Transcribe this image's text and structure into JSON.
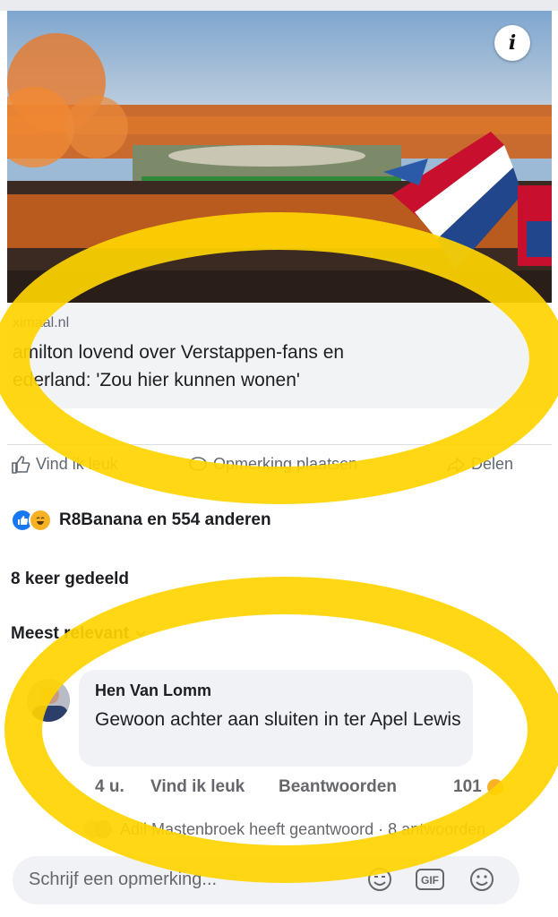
{
  "hero": {
    "info_glyph": "i"
  },
  "link": {
    "domain": "ximaal.nl",
    "headline_line1": "amilton lovend over Verstappen-fans en",
    "headline_line2": "ederland: 'Zou hier kunnen wonen'"
  },
  "actions": {
    "like": "Vind ik leuk",
    "comment": "Opmerking plaatsen",
    "share": "Delen"
  },
  "reactions": {
    "summary": "R8Banana en 554 anderen",
    "icons": [
      "like-icon",
      "haha-icon"
    ]
  },
  "shares": {
    "label": "8 keer gedeeld"
  },
  "sort": {
    "label": "Meest relevant"
  },
  "comment": {
    "author": "Hen Van Lomm",
    "text": "Gewoon achter aan sluiten in ter Apel Lewis",
    "time": "4 u.",
    "like": "Vind ik leuk",
    "reply": "Beantwoorden",
    "reaction_count": "101"
  },
  "reply_notice": {
    "text": "Adil Mastenbroek heeft geantwoord · 8 antwoorden"
  },
  "composer": {
    "placeholder": "Schrijf een opmerking..."
  },
  "colors": {
    "highlight": "#ffd400",
    "accent": "#1877f2"
  }
}
